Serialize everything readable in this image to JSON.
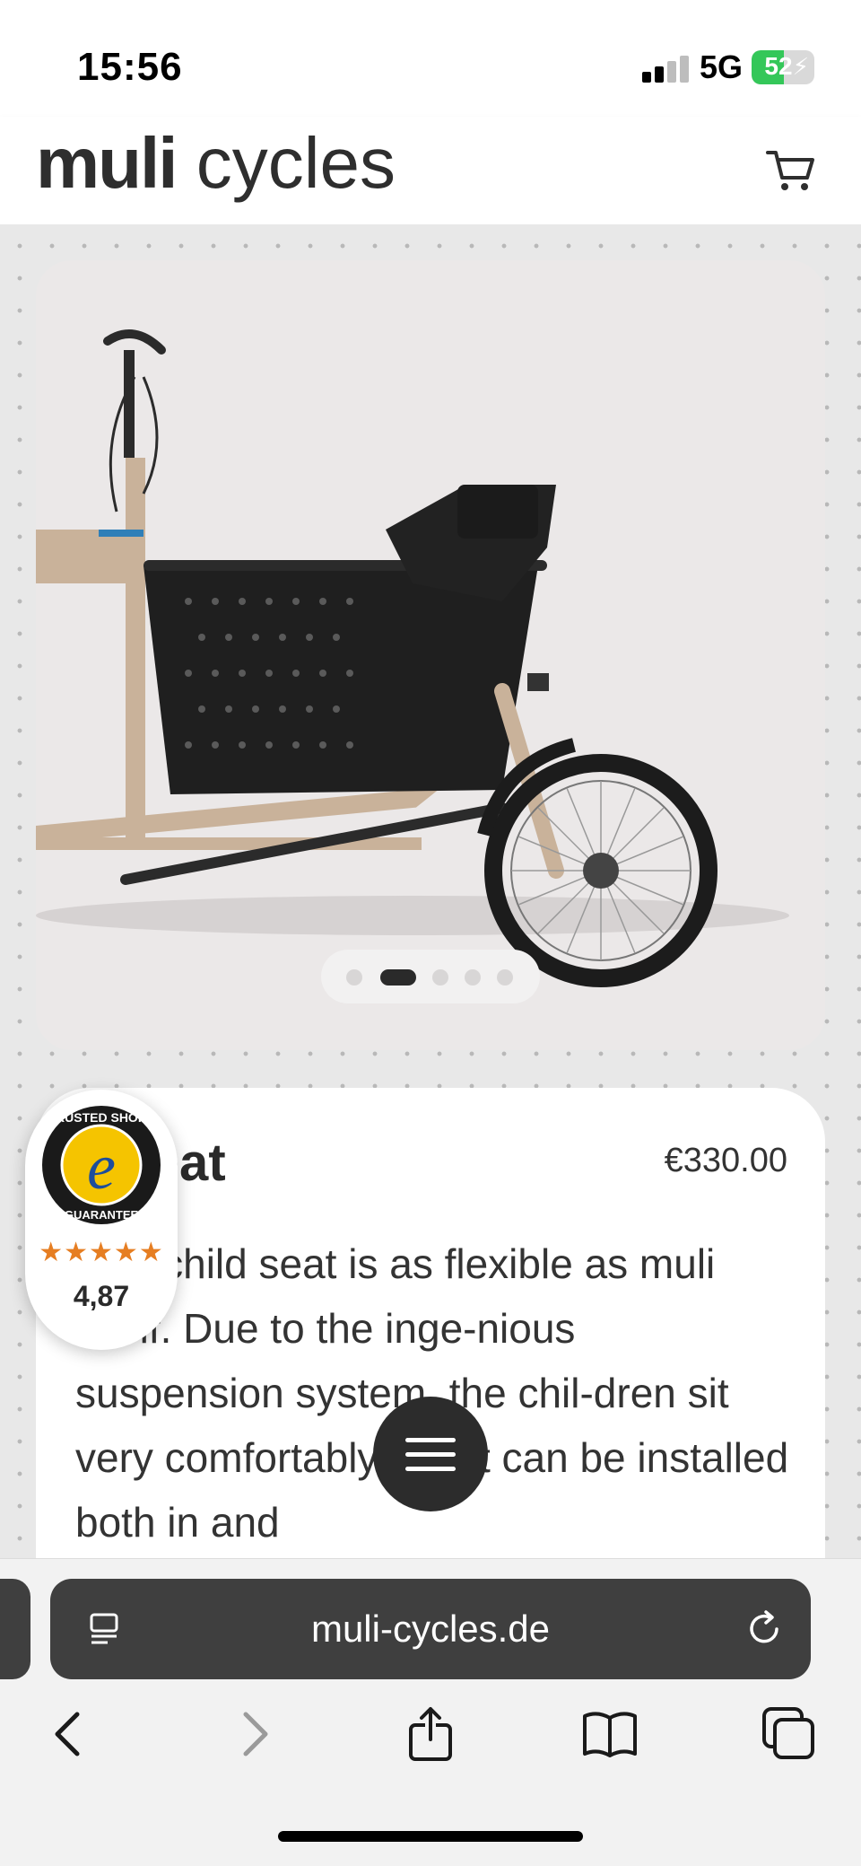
{
  "status_bar": {
    "time": "15:56",
    "network": "5G",
    "battery": "52"
  },
  "header": {
    "brand_bold": "muli",
    "brand_light": "cycles",
    "cart_icon": "cart-icon"
  },
  "product": {
    "title": "d seat",
    "price": "€330.00",
    "description": "muli child seat is as flexible as muli itself. Due to the inge-nious suspension system, the chil-dren sit very comfortably and it can be installed both in and",
    "image_alt": "muli cargo bike with child seat",
    "carousel": {
      "total": 5,
      "active_index": 1
    }
  },
  "trust_badge": {
    "seal_letter": "e",
    "seal_top_text": "TRUSTED SHOPS",
    "seal_bottom_text": "GUARANTEE",
    "stars": "★★★★★",
    "rating": "4,87"
  },
  "menu": {
    "icon": "hamburger-menu-icon"
  },
  "browser": {
    "url": "muli-cycles.de",
    "icons": [
      "reader-icon",
      "reload-icon",
      "back-icon",
      "forward-icon",
      "share-icon",
      "bookmarks-icon",
      "tabs-icon"
    ]
  },
  "colors": {
    "accent_dark": "#2a2a2a",
    "star_orange": "#e67e22",
    "battery_green": "#34c759",
    "frame_beige": "#c9b29a"
  }
}
